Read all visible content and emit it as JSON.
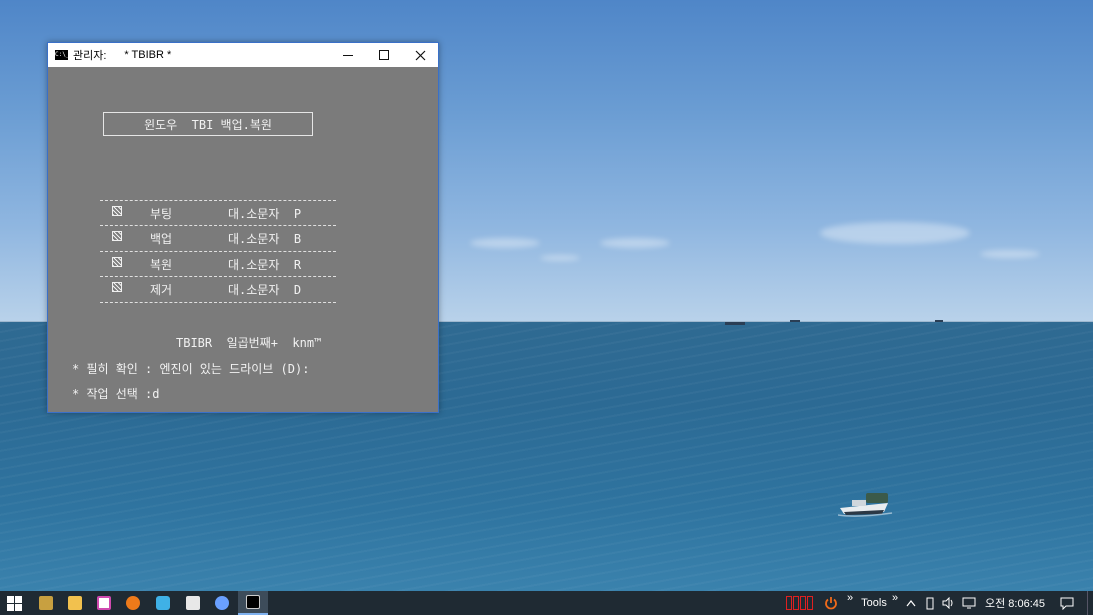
{
  "window": {
    "title_prefix": "관리자:",
    "title": "* TBIBR *",
    "app_icon_text": "C:\\_"
  },
  "console": {
    "header": "윈도우  TBI 백업.복원",
    "menu": [
      {
        "label": "부팅",
        "key": "대.소문자  P"
      },
      {
        "label": "백업",
        "key": "대.소문자  B"
      },
      {
        "label": "복원",
        "key": "대.소문자  R"
      },
      {
        "label": "제거",
        "key": "대.소문자  D"
      }
    ],
    "credit": "TBIBR  일곱번째+  knm™",
    "notice": "* 필히 확인 : 엔진이 있는 드라이브 (D):",
    "prompt": "* 작업 선택 :d"
  },
  "taskbar": {
    "tools_label": "Tools",
    "chevron_glyph": "»",
    "clock": "오전 8:06:45",
    "pinned_apps": [
      {
        "icon": "notepad-icon",
        "color": "#c8a040"
      },
      {
        "icon": "file-explorer-icon",
        "color": "#f2c14e"
      },
      {
        "icon": "app-k-icon",
        "color": "#d04ab0"
      },
      {
        "icon": "orange-app-icon",
        "color": "#ee7a1a"
      },
      {
        "icon": "bird-app-icon",
        "color": "#3fb1e6"
      },
      {
        "icon": "tools-app-icon",
        "color": "#e8e8e8"
      },
      {
        "icon": "network-app-icon",
        "color": "#6aa0ff"
      },
      {
        "icon": "command-prompt-icon",
        "color": "#000000"
      }
    ]
  },
  "colors": {
    "console_bg": "#7b7b7b",
    "console_text": "#f2f2f2",
    "taskbar_bg": "#1f2a33",
    "active_task_bg": "#3d4c5a",
    "window_border": "#3a70c8"
  }
}
